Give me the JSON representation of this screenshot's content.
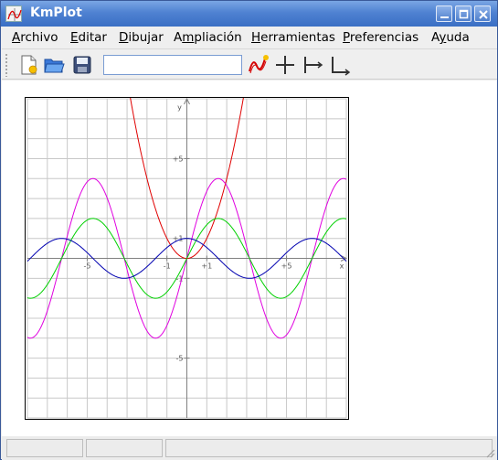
{
  "window": {
    "title": "KmPlot"
  },
  "menu": [
    {
      "label": "Archivo",
      "accel": "A",
      "rest": "rchivo"
    },
    {
      "label": "Editar",
      "accel": "E",
      "rest": "ditar"
    },
    {
      "label": "Dibujar",
      "accel": "D",
      "rest": "ibujar"
    },
    {
      "label": "Ampliación",
      "accel": "",
      "pre": "A",
      "mid": "m",
      "rest": "pliación"
    },
    {
      "label": "Herramientas",
      "accel": "H",
      "rest": "erramientas"
    },
    {
      "label": "Preferencias",
      "accel": "P",
      "rest": "referencias"
    },
    {
      "label": "Ayuda",
      "accel": "",
      "pre": "A",
      "mid": "y",
      "rest": "uda"
    }
  ],
  "toolbar": {
    "function_input_value": "",
    "icons": [
      "new-document-icon",
      "open-folder-icon",
      "save-disk-icon",
      "new-function-icon",
      "axes-center-icon",
      "axes-left-icon",
      "axes-corner-icon"
    ]
  },
  "plot": {
    "xlim": [
      -8,
      8
    ],
    "ylim": [
      -8,
      8
    ],
    "grid": true,
    "x_tick_labels": [
      "-5",
      "-1",
      "+1",
      "+5"
    ],
    "y_tick_labels": [
      "+5",
      "+1",
      "-1",
      "-5"
    ],
    "x_axis_label": "x",
    "y_axis_label": "y",
    "functions": [
      {
        "expr": "x^2",
        "color": "#e00000"
      },
      {
        "expr": "4sin(x)",
        "color": "#e000e0"
      },
      {
        "expr": "2sin(x)",
        "color": "#00d000"
      },
      {
        "expr": "cos(x)",
        "color": "#0000b0"
      }
    ]
  },
  "colors": {
    "titlebar": "#4f82d2",
    "grid": "#c8c8c8",
    "axes": "#808080"
  },
  "statusbar": {
    "cells": [
      "",
      "",
      ""
    ]
  }
}
